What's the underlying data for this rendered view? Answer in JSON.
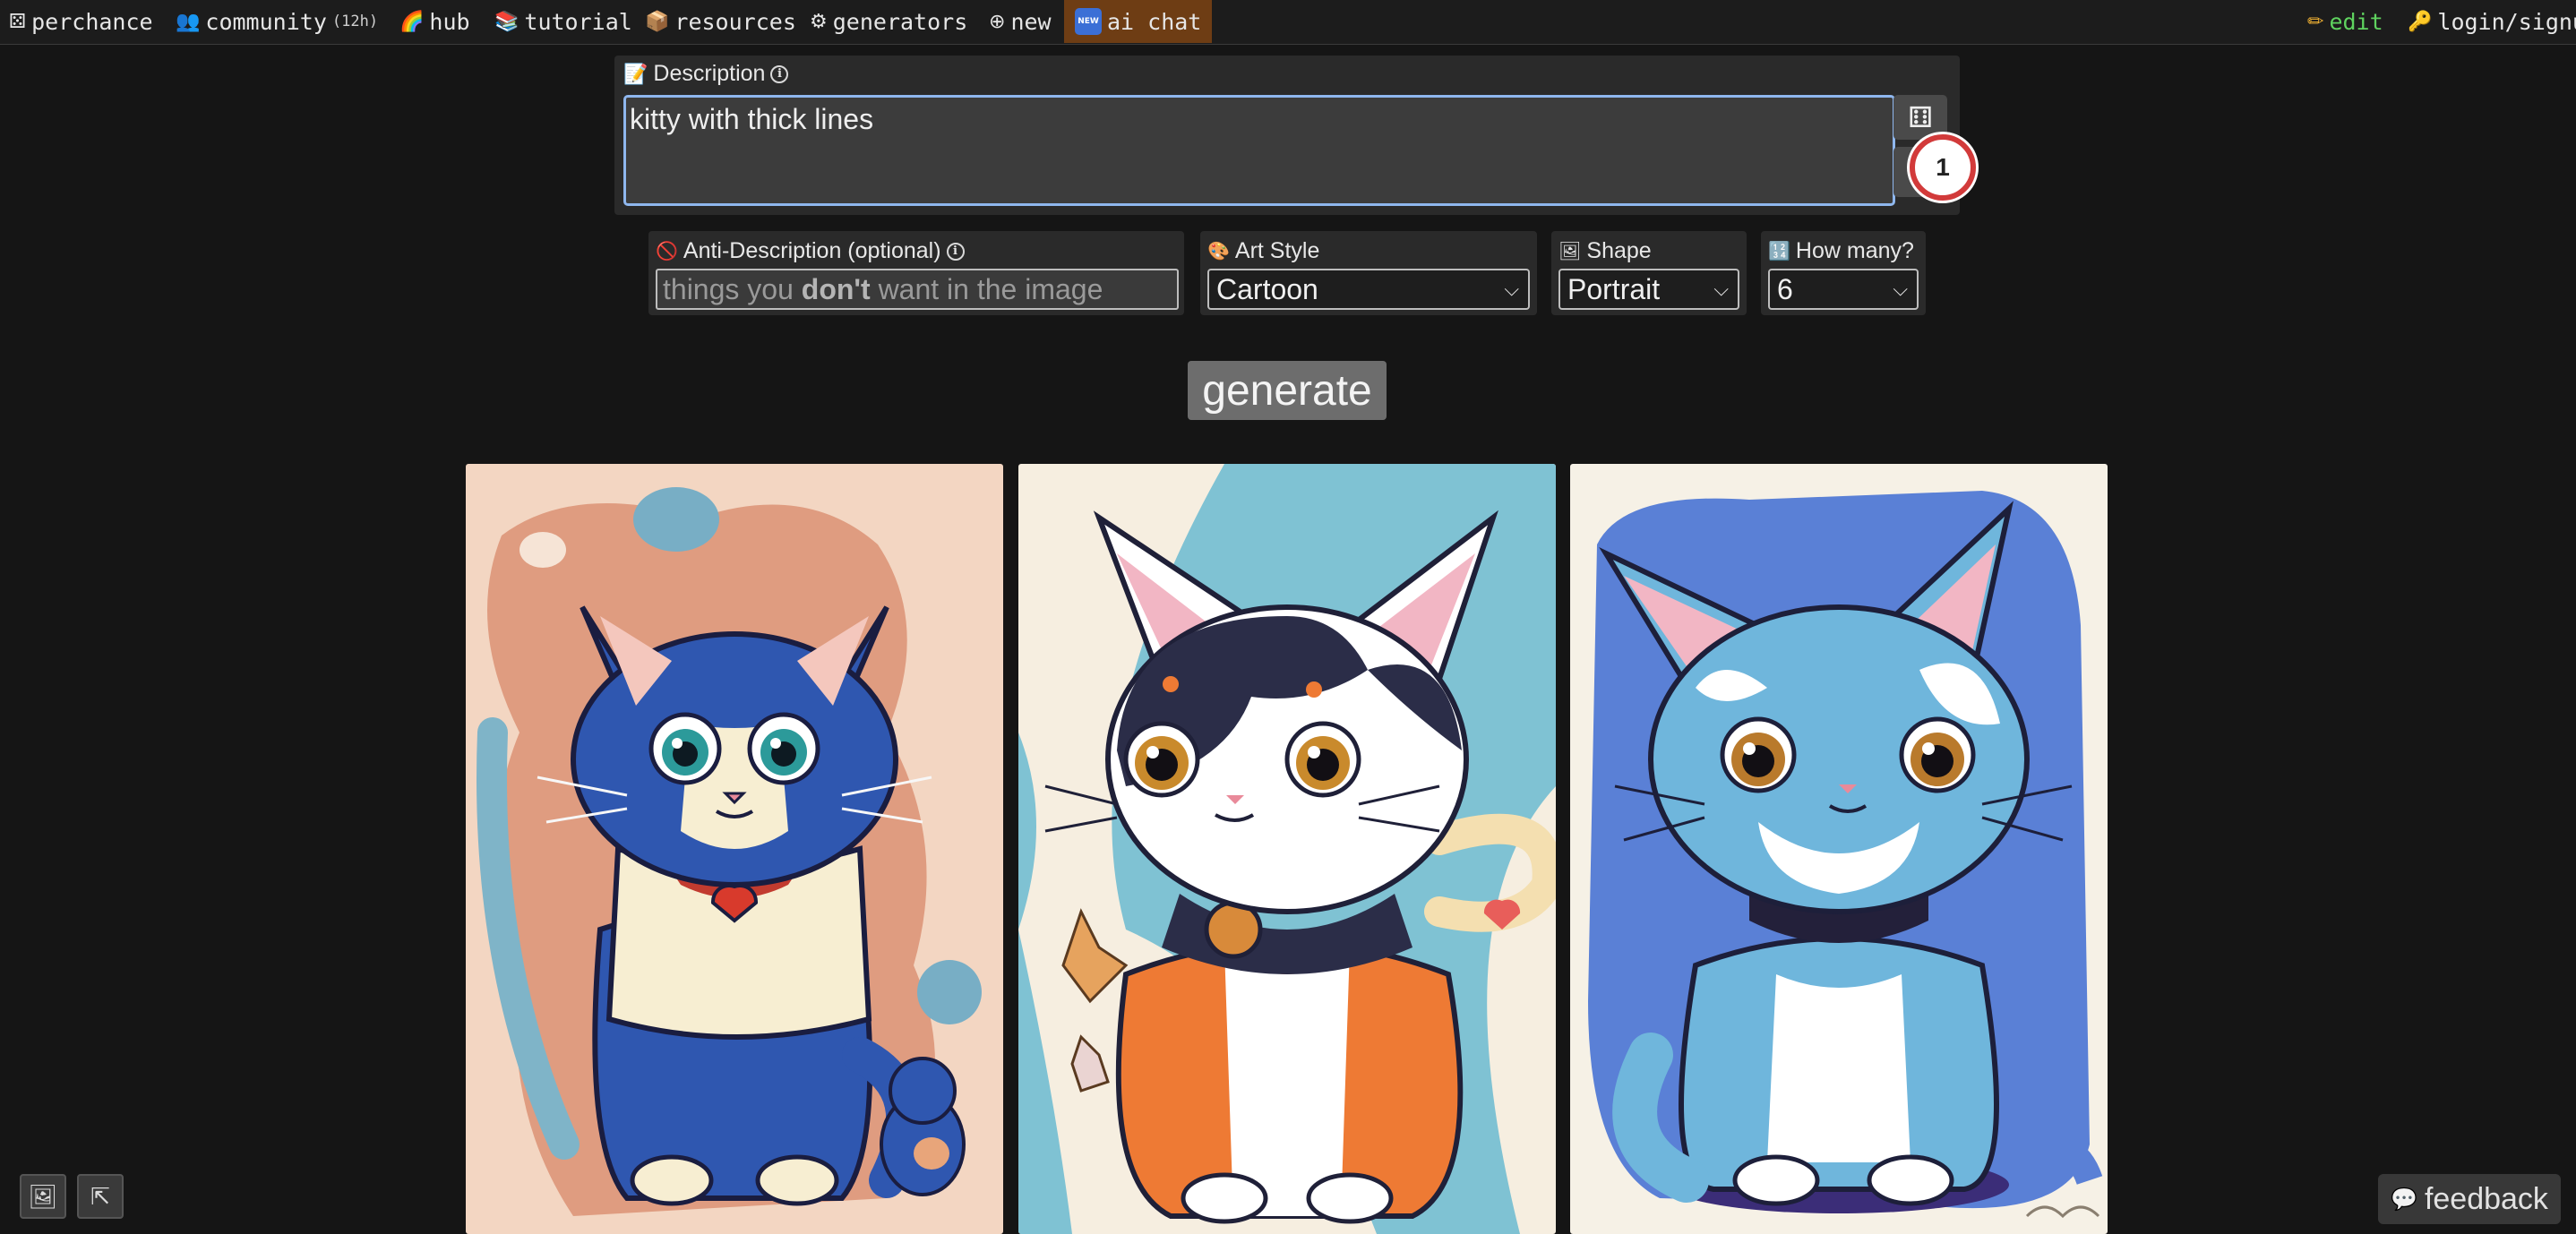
{
  "nav": {
    "items": [
      {
        "icon": "⚄",
        "label": "perchance"
      },
      {
        "icon": "👥",
        "label": "community",
        "note": "(12h)"
      },
      {
        "icon": "🌈",
        "label": "hub"
      },
      {
        "icon": "📚",
        "label": "tutorial"
      },
      {
        "icon": "📦",
        "label": "resources"
      },
      {
        "icon": "⚙",
        "label": "generators"
      },
      {
        "icon": "⊕",
        "label": "new"
      },
      {
        "icon": "NEW",
        "label": "ai chat"
      }
    ],
    "right": [
      {
        "icon": "✏",
        "label": "edit"
      },
      {
        "icon": "🔑",
        "label": "login/signu"
      }
    ],
    "colors": {
      "ai_chat_bg": "#6e3d14",
      "edit": "#5fd35f"
    }
  },
  "description": {
    "icon": "📝",
    "label": "Description",
    "info": "i",
    "value": "kitty with thick lines",
    "dice_icon": "⚅",
    "step_badge": "1"
  },
  "anti_description": {
    "icon": "🚫",
    "label": "Anti-Description (optional)",
    "info": "i",
    "placeholder_before": "things you ",
    "placeholder_bold": "don't",
    "placeholder_after": " want in the image"
  },
  "art_style": {
    "icon": "🎨",
    "label": "Art Style",
    "value": "Cartoon",
    "chevron": "⌵"
  },
  "shape": {
    "icon": "🖼",
    "label": "Shape",
    "value": "Portrait",
    "chevron": "⌵"
  },
  "how_many": {
    "icon": "🔢",
    "label": "How many?",
    "value": "6",
    "chevron": "⌵"
  },
  "generate_label": "generate",
  "images": [
    {
      "subject": "blue-cat-with-collar",
      "palette": {
        "bg": "#f3d6c2",
        "blob": "#df9c80",
        "fur": "#2f57b0",
        "accent": "#ffffff"
      }
    },
    {
      "subject": "calico-cat-orange-sweater",
      "palette": {
        "bg": "#f6eee0",
        "blob": "#7fc2d3",
        "fur": "#2b2d48",
        "accent": "#ee7a34"
      }
    },
    {
      "subject": "light-blue-cat",
      "palette": {
        "bg": "#f6f1e6",
        "blob": "#5a80d6",
        "fur": "#6fb6dc",
        "accent": "#ffffff"
      }
    }
  ],
  "bottom": {
    "left_icon_1": "🖼",
    "left_icon_2": "⇱",
    "feedback_icon": "💬",
    "feedback_label": "feedback"
  }
}
